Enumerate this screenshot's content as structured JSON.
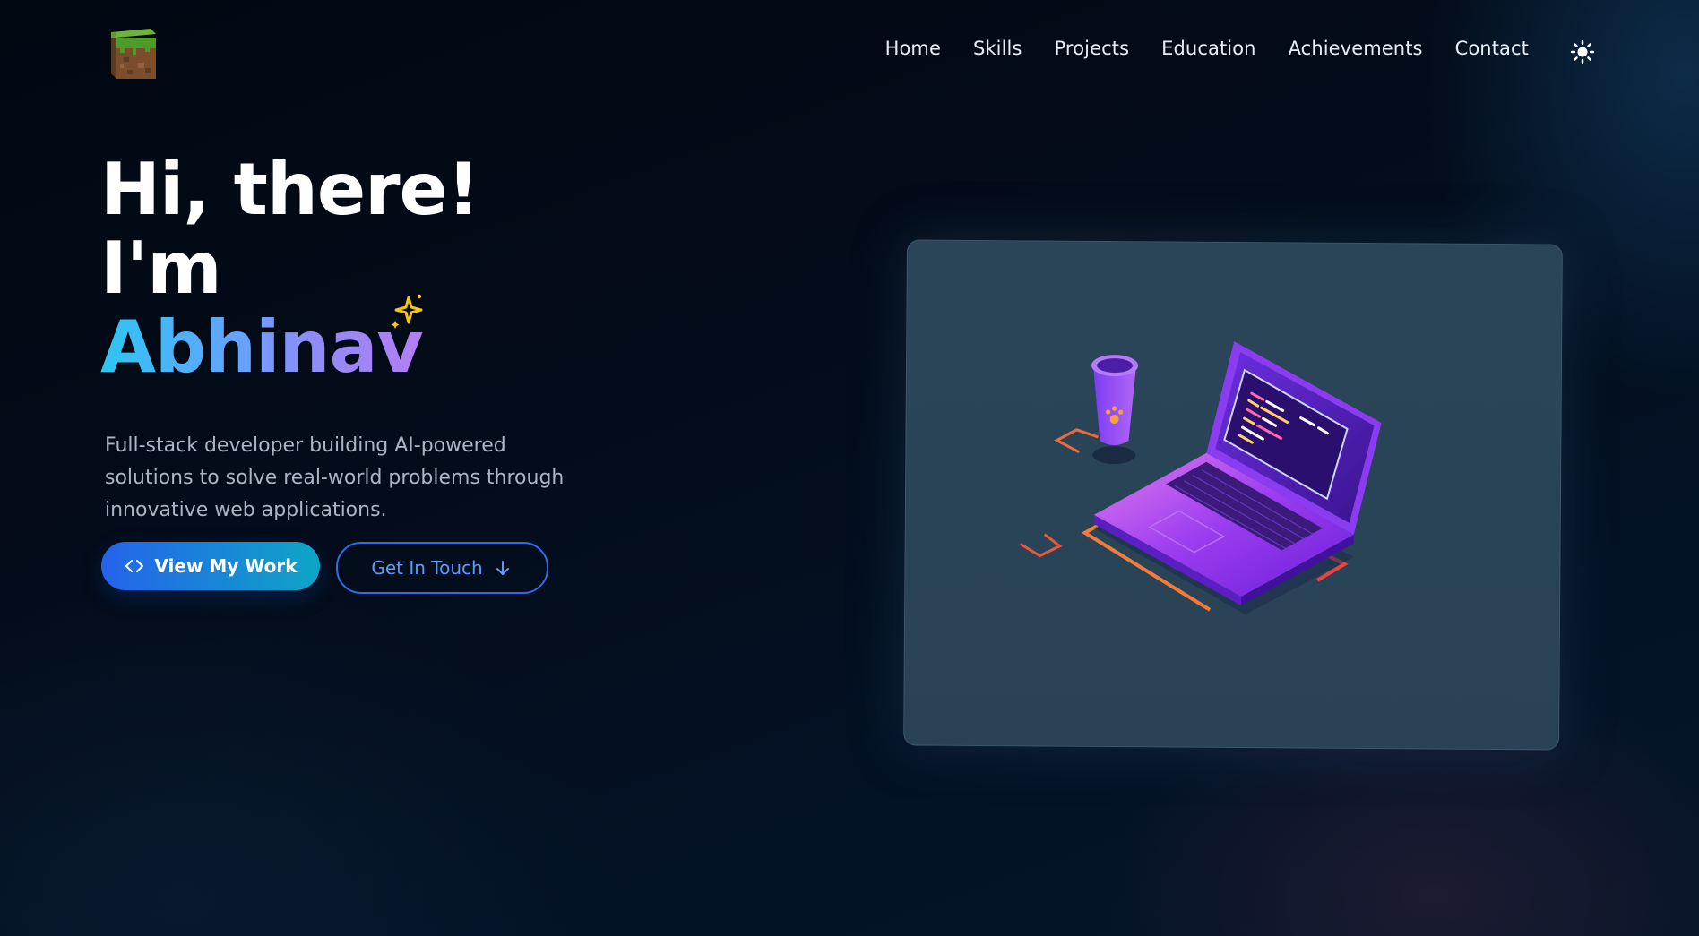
{
  "nav": {
    "items": [
      {
        "label": "Home",
        "name": "nav-home"
      },
      {
        "label": "Skills",
        "name": "nav-skills"
      },
      {
        "label": "Projects",
        "name": "nav-projects"
      },
      {
        "label": "Education",
        "name": "nav-education"
      },
      {
        "label": "Achievements",
        "name": "nav-achievements"
      },
      {
        "label": "Contact",
        "name": "nav-contact"
      }
    ],
    "theme_icon": "sun-icon",
    "logo_icon": "grass-block-icon"
  },
  "hero": {
    "greeting": "Hi, there!",
    "intro": "I'm",
    "name": "Abhinav",
    "sparkle_icon": "sparkle-icon",
    "subtitle": "Full-stack developer building AI-powered solutions to solve real-world problems through innovative web applications."
  },
  "buttons": {
    "primary_label": "View My Work",
    "primary_icon": "code-icon",
    "secondary_label": "Get In Touch",
    "secondary_icon": "arrow-down-icon"
  },
  "illustration": {
    "icon": "laptop-coffee-illustration"
  },
  "colors": {
    "accent_blue": "#2563eb",
    "accent_cyan": "#0ea5c6",
    "name_gradient_start": "#2ec6f0",
    "name_gradient_end": "#b57df3",
    "background": "#030c1a",
    "card_bg": "#2a4458"
  }
}
